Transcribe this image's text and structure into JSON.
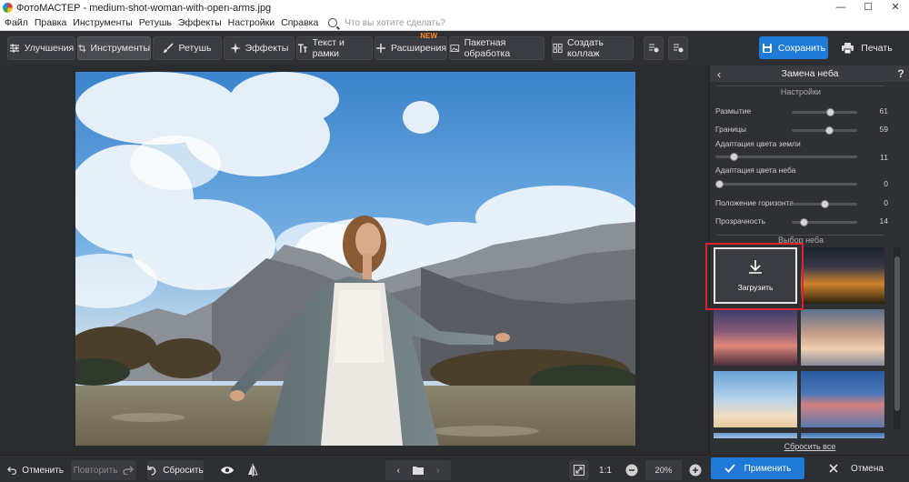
{
  "window": {
    "title": "ФотоМАСТЕР - medium-shot-woman-with-open-arms.jpg",
    "controls": [
      "—",
      "☐",
      "✕"
    ]
  },
  "menu": {
    "items": [
      "Файл",
      "Правка",
      "Инструменты",
      "Ретушь",
      "Эффекты",
      "Настройки",
      "Справка"
    ],
    "search_placeholder": "Что вы хотите сделать?"
  },
  "toolbar": {
    "tabs": [
      {
        "label": "Улучшения",
        "icon": "sliders-icon"
      },
      {
        "label": "Инструменты",
        "icon": "crop-icon",
        "active": true
      },
      {
        "label": "Ретушь",
        "icon": "brush-icon"
      },
      {
        "label": "Эффекты",
        "icon": "sparkle-icon"
      },
      {
        "label": "Текст и рамки",
        "icon": "text-icon"
      },
      {
        "label": "Расширения",
        "icon": "plus-icon",
        "badge": "NEW"
      },
      {
        "label": "Пакетная обработка",
        "icon": "images-icon"
      },
      {
        "label": "Создать коллаж",
        "icon": "collage-icon"
      }
    ],
    "save_label": "Сохранить",
    "print_label": "Печать"
  },
  "panel": {
    "title": "Замена неба",
    "back_icon": "chevron-left-icon",
    "help": "?",
    "settings_label": "Настройки",
    "settings": [
      {
        "label": "Размытие",
        "value": "61",
        "level": 0.61
      },
      {
        "label": "Границы",
        "value": "59",
        "level": 0.59
      },
      {
        "label": "Адаптация цвета земли",
        "value": "11",
        "level": 0.11
      },
      {
        "label": "Адаптация цвета неба",
        "value": "0",
        "level": 0.0
      },
      {
        "label": "Положение горизонта",
        "value": "0",
        "level": 0.5
      },
      {
        "label": "Прозрачность",
        "value": "14",
        "level": 0.14
      }
    ],
    "sky_label": "Выбор неба",
    "upload_label": "Загрузить",
    "reset_all": "Сбросить все"
  },
  "bottom": {
    "undo": "Отменить",
    "redo": "Повторить",
    "reset": "Сбросить",
    "ratio": "1:1",
    "zoom": "20%",
    "apply": "Применить",
    "cancel": "Отмена"
  },
  "colors": {
    "accent": "#1e7ad6",
    "highlight": "#e0242c",
    "new_badge": "#ff8a1e"
  }
}
